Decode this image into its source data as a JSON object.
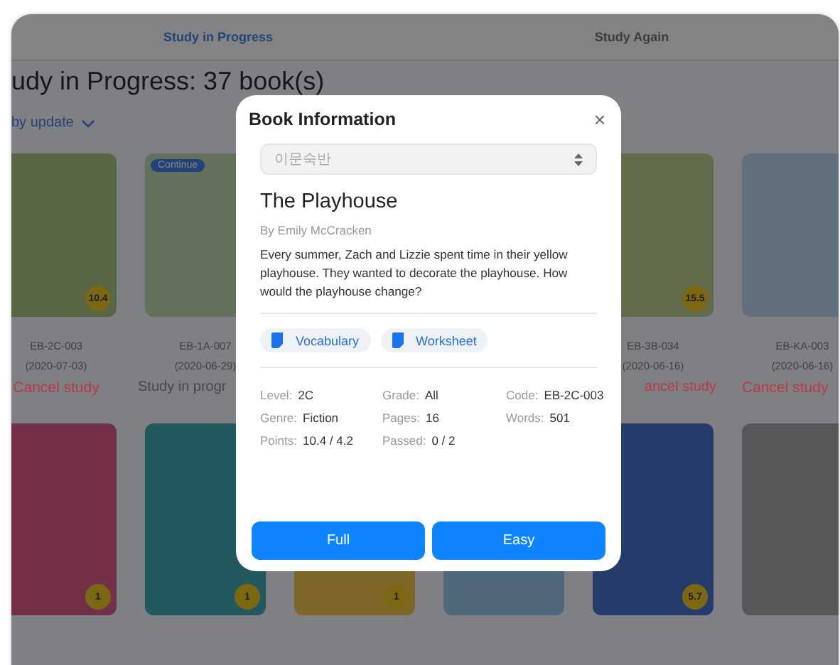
{
  "tabs": [
    {
      "label": "Study in Progress",
      "selected": true
    },
    {
      "label": "Study Again",
      "selected": false
    }
  ],
  "heading": "udy in Progress: 37 book(s)",
  "sort": {
    "label": "by update"
  },
  "books_row_1": [
    {
      "badge": "10.4",
      "code": "EB-2C-003",
      "date": "(2020-07-03)",
      "status": {
        "label": "Cancel study",
        "color": "#b83a44"
      }
    },
    {
      "tag": "Continue",
      "code": "EB-1A-007",
      "date": "(2020-06-29)",
      "status": {
        "label": "Study in progr",
        "color": "#48484b"
      }
    },
    {
      "badge": "15.5",
      "code": "EB-3B-034",
      "date": "(2020-06-16)",
      "status": {
        "label": "ancel study",
        "color": "#b83a44"
      }
    },
    {
      "code": "EB-KA-003",
      "date": "(2020-06-16)",
      "status": {
        "label": "Cancel study",
        "color": "#b83a44"
      }
    }
  ],
  "books_row_2_badges": [
    "1",
    "1",
    "1",
    "5.7"
  ],
  "dialog": {
    "title": "Book Information",
    "close": "×",
    "class_select": {
      "placeholder": "이문숙반"
    },
    "book_title": "The Playhouse",
    "author": "By Emily McCracken",
    "description": "Every summer, Zach and Lizzie spent time in their yellow playhouse. They wanted to decorate the playhouse. How would the playhouse change?",
    "resources": [
      {
        "label": "Vocabulary"
      },
      {
        "label": "Worksheet"
      }
    ],
    "details": [
      {
        "label": "Level:",
        "value": "2C"
      },
      {
        "label": "Grade:",
        "value": "All"
      },
      {
        "label": "Code:",
        "value": "EB-2C-003"
      },
      {
        "label": "Genre:",
        "value": "Fiction"
      },
      {
        "label": "Pages:",
        "value": "16"
      },
      {
        "label": "Words:",
        "value": "501"
      },
      {
        "label": "Points:",
        "value": "10.4 / 4.2"
      },
      {
        "label": "Passed:",
        "value": "0 / 2"
      }
    ],
    "buttons": [
      {
        "label": "Full"
      },
      {
        "label": "Easy"
      }
    ]
  }
}
